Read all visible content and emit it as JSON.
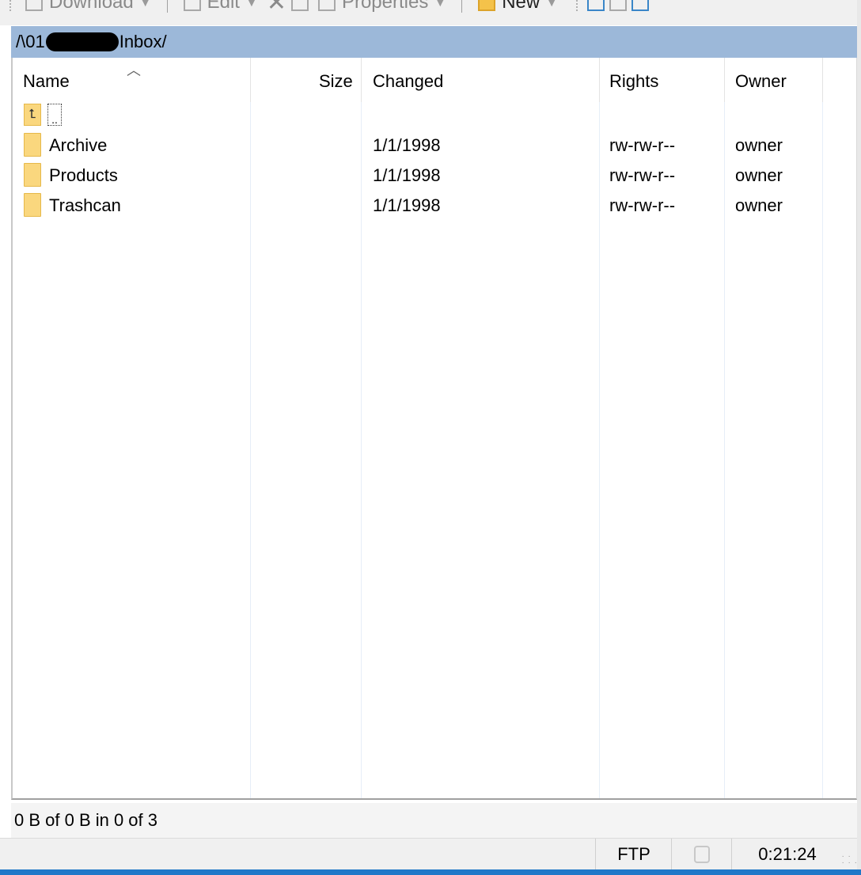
{
  "toolbar": {
    "download_label": "Download",
    "edit_label": "Edit",
    "properties_label": "Properties",
    "new_label": "New"
  },
  "path": {
    "prefix": "/\\01",
    "suffix": "Inbox/"
  },
  "columns": {
    "name": "Name",
    "size": "Size",
    "changed": "Changed",
    "rights": "Rights",
    "owner": "Owner"
  },
  "parent": {
    "label": ".."
  },
  "rows": [
    {
      "name": "Archive",
      "size": "",
      "changed": "1/1/1998",
      "rights": "rw-rw-r--",
      "owner": "owner"
    },
    {
      "name": "Products",
      "size": "",
      "changed": "1/1/1998",
      "rights": "rw-rw-r--",
      "owner": "owner"
    },
    {
      "name": "Trashcan",
      "size": "",
      "changed": "1/1/1998",
      "rights": "rw-rw-r--",
      "owner": "owner"
    }
  ],
  "status": {
    "selection": "0 B of 0 B in 0 of 3",
    "protocol": "FTP",
    "elapsed": "0:21:24"
  },
  "colors": {
    "pathbar": "#9cb8d9",
    "folder": "#fad77e",
    "accent_edge": "#1f78c8"
  },
  "icons": {
    "parent": "parent-folder-icon",
    "folder": "folder-icon",
    "lock": "lock-icon"
  }
}
